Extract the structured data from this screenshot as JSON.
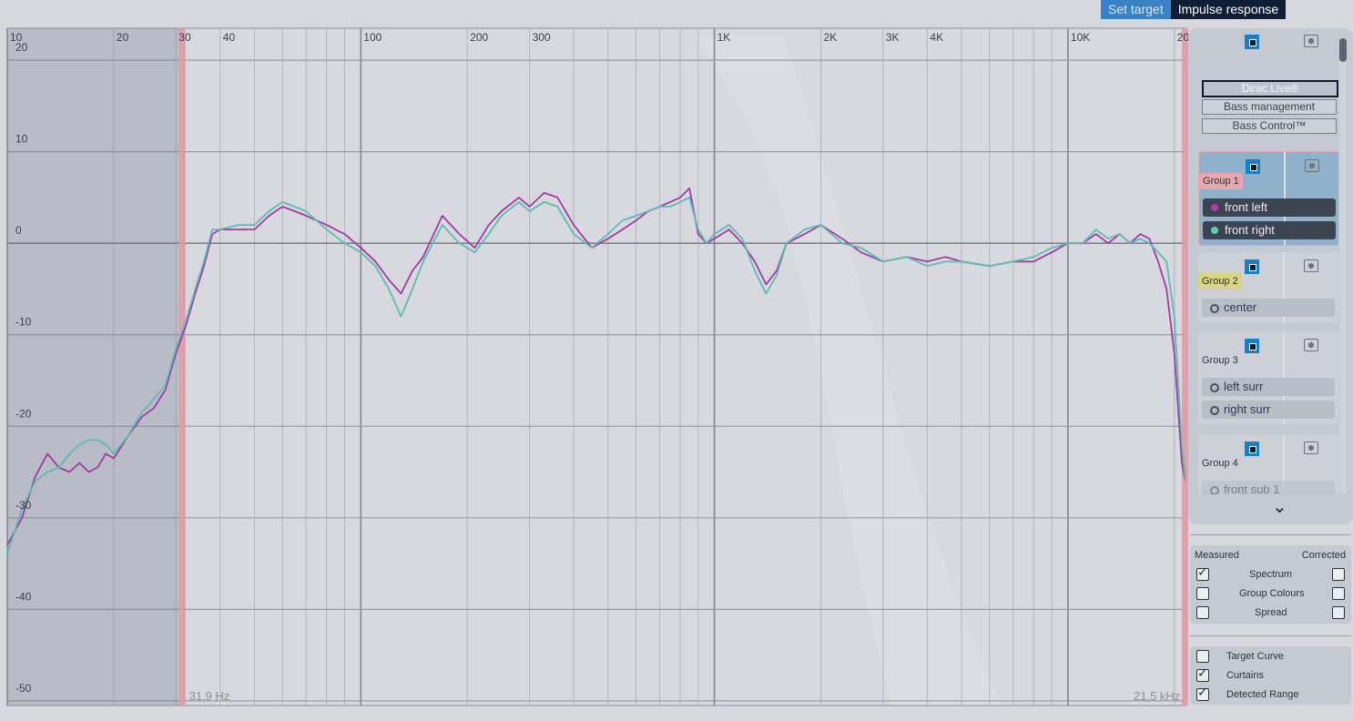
{
  "tabs": {
    "set_target": "Set target",
    "impulse_response": "Impulse response"
  },
  "chart_data": {
    "type": "line",
    "x_scale": "log",
    "xlim": [
      10,
      21500
    ],
    "ylim": [
      -52,
      22
    ],
    "grid": true,
    "x_tick_labels": [
      {
        "value": 10,
        "label": "10"
      },
      {
        "value": 20,
        "label": "20"
      },
      {
        "value": 30,
        "label": "30"
      },
      {
        "value": 40,
        "label": "40"
      },
      {
        "value": 100,
        "label": "100"
      },
      {
        "value": 200,
        "label": "200"
      },
      {
        "value": 300,
        "label": "300"
      },
      {
        "value": 1000,
        "label": "1K"
      },
      {
        "value": 2000,
        "label": "2K"
      },
      {
        "value": 3000,
        "label": "3K"
      },
      {
        "value": 4000,
        "label": "4K"
      },
      {
        "value": 10000,
        "label": "10K"
      },
      {
        "value": 20000,
        "label": "20K"
      }
    ],
    "y_tick_labels": [
      {
        "value": 20,
        "label": "20"
      },
      {
        "value": 10,
        "label": "10"
      },
      {
        "value": 0,
        "label": "0"
      },
      {
        "value": -10,
        "label": "-10"
      },
      {
        "value": -20,
        "label": "-20"
      },
      {
        "value": -30,
        "label": "-30"
      },
      {
        "value": -40,
        "label": "-40"
      },
      {
        "value": -50,
        "label": "-50"
      }
    ],
    "curtain_low_hz": 31.9,
    "curtain_high_hz": 21500,
    "curtain_low_label": "31,9 Hz",
    "curtain_high_label": "21,5 kHz",
    "series": [
      {
        "name": "front left",
        "color": "#a33aa8",
        "points": [
          [
            10,
            -33
          ],
          [
            11,
            -30
          ],
          [
            12,
            -25.5
          ],
          [
            13,
            -23
          ],
          [
            14,
            -24.5
          ],
          [
            15,
            -25
          ],
          [
            16,
            -24
          ],
          [
            17,
            -25
          ],
          [
            18,
            -24.5
          ],
          [
            19,
            -23
          ],
          [
            20,
            -23.5
          ],
          [
            22,
            -21
          ],
          [
            24,
            -19
          ],
          [
            26,
            -18
          ],
          [
            28,
            -16
          ],
          [
            30,
            -12
          ],
          [
            32,
            -9
          ],
          [
            34,
            -5.5
          ],
          [
            36,
            -2.5
          ],
          [
            38,
            1
          ],
          [
            40,
            1.5
          ],
          [
            45,
            1.5
          ],
          [
            50,
            1.5
          ],
          [
            55,
            3
          ],
          [
            60,
            4
          ],
          [
            65,
            3.5
          ],
          [
            70,
            3
          ],
          [
            80,
            2
          ],
          [
            90,
            1
          ],
          [
            100,
            -0.5
          ],
          [
            110,
            -2
          ],
          [
            120,
            -4
          ],
          [
            130,
            -5.5
          ],
          [
            140,
            -3
          ],
          [
            150,
            -1.5
          ],
          [
            170,
            3
          ],
          [
            190,
            1
          ],
          [
            210,
            -0.5
          ],
          [
            230,
            2
          ],
          [
            250,
            3.5
          ],
          [
            280,
            5
          ],
          [
            300,
            4
          ],
          [
            330,
            5.5
          ],
          [
            360,
            5
          ],
          [
            400,
            2
          ],
          [
            450,
            -0.5
          ],
          [
            500,
            0.5
          ],
          [
            550,
            1.5
          ],
          [
            600,
            2.5
          ],
          [
            650,
            3.5
          ],
          [
            700,
            4
          ],
          [
            750,
            4.5
          ],
          [
            800,
            5
          ],
          [
            850,
            6
          ],
          [
            900,
            1
          ],
          [
            950,
            0
          ],
          [
            1000,
            0.5
          ],
          [
            1100,
            1.5
          ],
          [
            1200,
            0
          ],
          [
            1300,
            -2
          ],
          [
            1400,
            -4.5
          ],
          [
            1500,
            -3
          ],
          [
            1600,
            0
          ],
          [
            1800,
            1
          ],
          [
            2000,
            2
          ],
          [
            2300,
            0.5
          ],
          [
            2600,
            -1
          ],
          [
            3000,
            -2
          ],
          [
            3500,
            -1.5
          ],
          [
            4000,
            -2
          ],
          [
            4500,
            -1.5
          ],
          [
            5000,
            -2
          ],
          [
            6000,
            -2.5
          ],
          [
            7000,
            -2
          ],
          [
            8000,
            -2
          ],
          [
            9000,
            -1
          ],
          [
            10000,
            0
          ],
          [
            11000,
            0
          ],
          [
            12000,
            1
          ],
          [
            13000,
            0
          ],
          [
            14000,
            1
          ],
          [
            15000,
            0
          ],
          [
            16000,
            1
          ],
          [
            17000,
            0.5
          ],
          [
            18000,
            -2
          ],
          [
            19000,
            -5
          ],
          [
            20000,
            -12
          ],
          [
            21000,
            -24
          ],
          [
            21500,
            -26
          ]
        ]
      },
      {
        "name": "front right",
        "color": "#5cbcb0",
        "points": [
          [
            10,
            -34
          ],
          [
            11,
            -29
          ],
          [
            12,
            -26
          ],
          [
            13,
            -25
          ],
          [
            14,
            -24.5
          ],
          [
            15,
            -23
          ],
          [
            16,
            -22
          ],
          [
            17,
            -21.5
          ],
          [
            18,
            -21.5
          ],
          [
            19,
            -22
          ],
          [
            20,
            -23
          ],
          [
            22,
            -21
          ],
          [
            24,
            -18.5
          ],
          [
            26,
            -17
          ],
          [
            28,
            -15.5
          ],
          [
            30,
            -11.5
          ],
          [
            32,
            -8.5
          ],
          [
            34,
            -5
          ],
          [
            36,
            -2
          ],
          [
            38,
            1.5
          ],
          [
            40,
            1.5
          ],
          [
            45,
            2
          ],
          [
            50,
            2
          ],
          [
            55,
            3.5
          ],
          [
            60,
            4.5
          ],
          [
            65,
            4
          ],
          [
            70,
            3.5
          ],
          [
            80,
            1.5
          ],
          [
            90,
            0
          ],
          [
            100,
            -1
          ],
          [
            110,
            -2.5
          ],
          [
            120,
            -5
          ],
          [
            130,
            -8
          ],
          [
            140,
            -5
          ],
          [
            150,
            -2
          ],
          [
            170,
            2
          ],
          [
            190,
            0
          ],
          [
            210,
            -1
          ],
          [
            230,
            1
          ],
          [
            250,
            3
          ],
          [
            280,
            4.5
          ],
          [
            300,
            3.5
          ],
          [
            330,
            4.5
          ],
          [
            360,
            4
          ],
          [
            400,
            1
          ],
          [
            450,
            -0.5
          ],
          [
            500,
            1
          ],
          [
            550,
            2.5
          ],
          [
            600,
            3
          ],
          [
            650,
            3.5
          ],
          [
            700,
            4
          ],
          [
            750,
            4
          ],
          [
            800,
            4.5
          ],
          [
            850,
            5
          ],
          [
            900,
            1.5
          ],
          [
            950,
            0
          ],
          [
            1000,
            1
          ],
          [
            1100,
            2
          ],
          [
            1200,
            0.5
          ],
          [
            1300,
            -3
          ],
          [
            1400,
            -5.5
          ],
          [
            1500,
            -3.5
          ],
          [
            1600,
            0
          ],
          [
            1800,
            1.5
          ],
          [
            2000,
            2
          ],
          [
            2300,
            0
          ],
          [
            2600,
            -0.5
          ],
          [
            3000,
            -2
          ],
          [
            3500,
            -1.5
          ],
          [
            4000,
            -2.5
          ],
          [
            4500,
            -2
          ],
          [
            5000,
            -2
          ],
          [
            6000,
            -2.5
          ],
          [
            7000,
            -2
          ],
          [
            8000,
            -1.5
          ],
          [
            9000,
            -0.5
          ],
          [
            10000,
            0
          ],
          [
            11000,
            0
          ],
          [
            12000,
            1.5
          ],
          [
            13000,
            0.5
          ],
          [
            14000,
            1
          ],
          [
            15000,
            0
          ],
          [
            16000,
            0.5
          ],
          [
            17000,
            0
          ],
          [
            18000,
            -1
          ],
          [
            19000,
            -2
          ],
          [
            20000,
            -8
          ],
          [
            21000,
            -22
          ],
          [
            21500,
            -26
          ]
        ]
      }
    ]
  },
  "sidebar": {
    "dirac_buttons": [
      "Dirac Live®",
      "Bass management",
      "Bass Control™"
    ],
    "groups": [
      {
        "label": "Group 1",
        "channels": [
          {
            "name": "front left",
            "color": "#b23bb0"
          },
          {
            "name": "front right",
            "color": "#5ecbb9"
          }
        ]
      },
      {
        "label": "Group 2",
        "channels": [
          {
            "name": "center"
          }
        ]
      },
      {
        "label": "Group 3",
        "channels": [
          {
            "name": "left surr"
          },
          {
            "name": "right surr"
          }
        ]
      },
      {
        "label": "Group 4",
        "channels": [
          {
            "name": "front sub 1"
          }
        ]
      }
    ]
  },
  "display_options": {
    "measured_header": "Measured",
    "corrected_header": "Corrected",
    "rows": [
      {
        "label": "Spectrum",
        "measured": true,
        "corrected": false
      },
      {
        "label": "Group Colours",
        "measured": false,
        "corrected": false
      },
      {
        "label": "Spread",
        "measured": false,
        "corrected": false
      }
    ],
    "toggles": [
      {
        "label": "Target Curve",
        "checked": false
      },
      {
        "label": "Curtains",
        "checked": true
      },
      {
        "label": "Detected Range",
        "checked": true
      }
    ]
  }
}
